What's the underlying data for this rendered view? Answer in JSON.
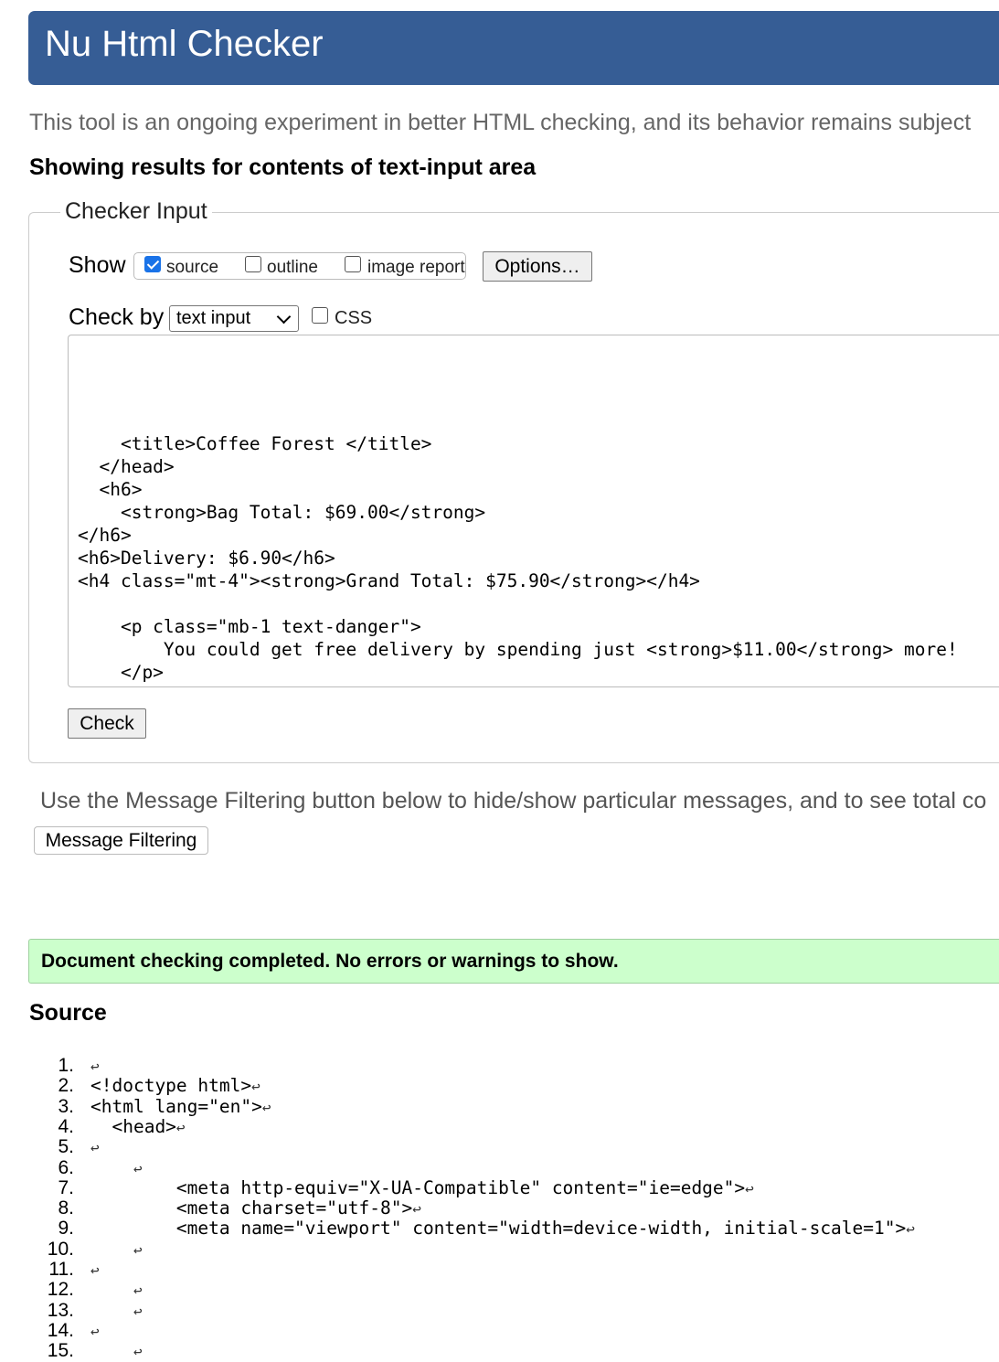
{
  "header": {
    "title": "Nu Html Checker"
  },
  "intro": "This tool is an ongoing experiment in better HTML checking, and its behavior remains subject",
  "results_heading": "Showing results for contents of text-input area",
  "checker_input": {
    "legend": "Checker Input",
    "show_label": "Show",
    "show_options": [
      {
        "label": "source",
        "checked": true
      },
      {
        "label": "outline",
        "checked": false
      },
      {
        "label": "image report",
        "checked": false
      }
    ],
    "options_button": "Options…",
    "check_by_label": "Check by",
    "check_by_value": "text input",
    "css_checkbox": {
      "label": "CSS",
      "checked": false
    },
    "textarea_lines": [
      "    <title>Coffee Forest </title>",
      "  </head>",
      "  <h6>",
      "    <strong>Bag Total: $69.00</strong>",
      "</h6>",
      "<h6>Delivery: $6.90</h6>",
      "<h4 class=\"mt-4\"><strong>Grand Total: $75.90</strong></h4>",
      "",
      "    <p class=\"mb-1 text-danger\">",
      "        You could get free delivery by spending just <strong>$11.00</strong> more!",
      "    </p>"
    ],
    "check_button": "Check"
  },
  "filter_note": "Use the Message Filtering button below to hide/show particular messages, and to see total co",
  "message_filtering_button": "Message Filtering",
  "status_message": "Document checking completed. No errors or warnings to show.",
  "source_heading": "Source",
  "source_lines": [
    {
      "num": "1.",
      "code": ""
    },
    {
      "num": "2.",
      "code": "<!doctype html>"
    },
    {
      "num": "3.",
      "code": "<html lang=\"en\">"
    },
    {
      "num": "4.",
      "code": "  <head>"
    },
    {
      "num": "5.",
      "code": ""
    },
    {
      "num": "6.",
      "code": "    "
    },
    {
      "num": "7.",
      "code": "        <meta http-equiv=\"X-UA-Compatible\" content=\"ie=edge\">"
    },
    {
      "num": "8.",
      "code": "        <meta charset=\"utf-8\">"
    },
    {
      "num": "9.",
      "code": "        <meta name=\"viewport\" content=\"width=device-width, initial-scale=1\">"
    },
    {
      "num": "10.",
      "code": "    "
    },
    {
      "num": "11.",
      "code": ""
    },
    {
      "num": "12.",
      "code": "    "
    },
    {
      "num": "13.",
      "code": "    "
    },
    {
      "num": "14.",
      "code": ""
    },
    {
      "num": "15.",
      "code": "    "
    }
  ],
  "return_glyph": "↩",
  "colors": {
    "header_bg": "#365d95",
    "success_bg": "#ccffcc"
  }
}
